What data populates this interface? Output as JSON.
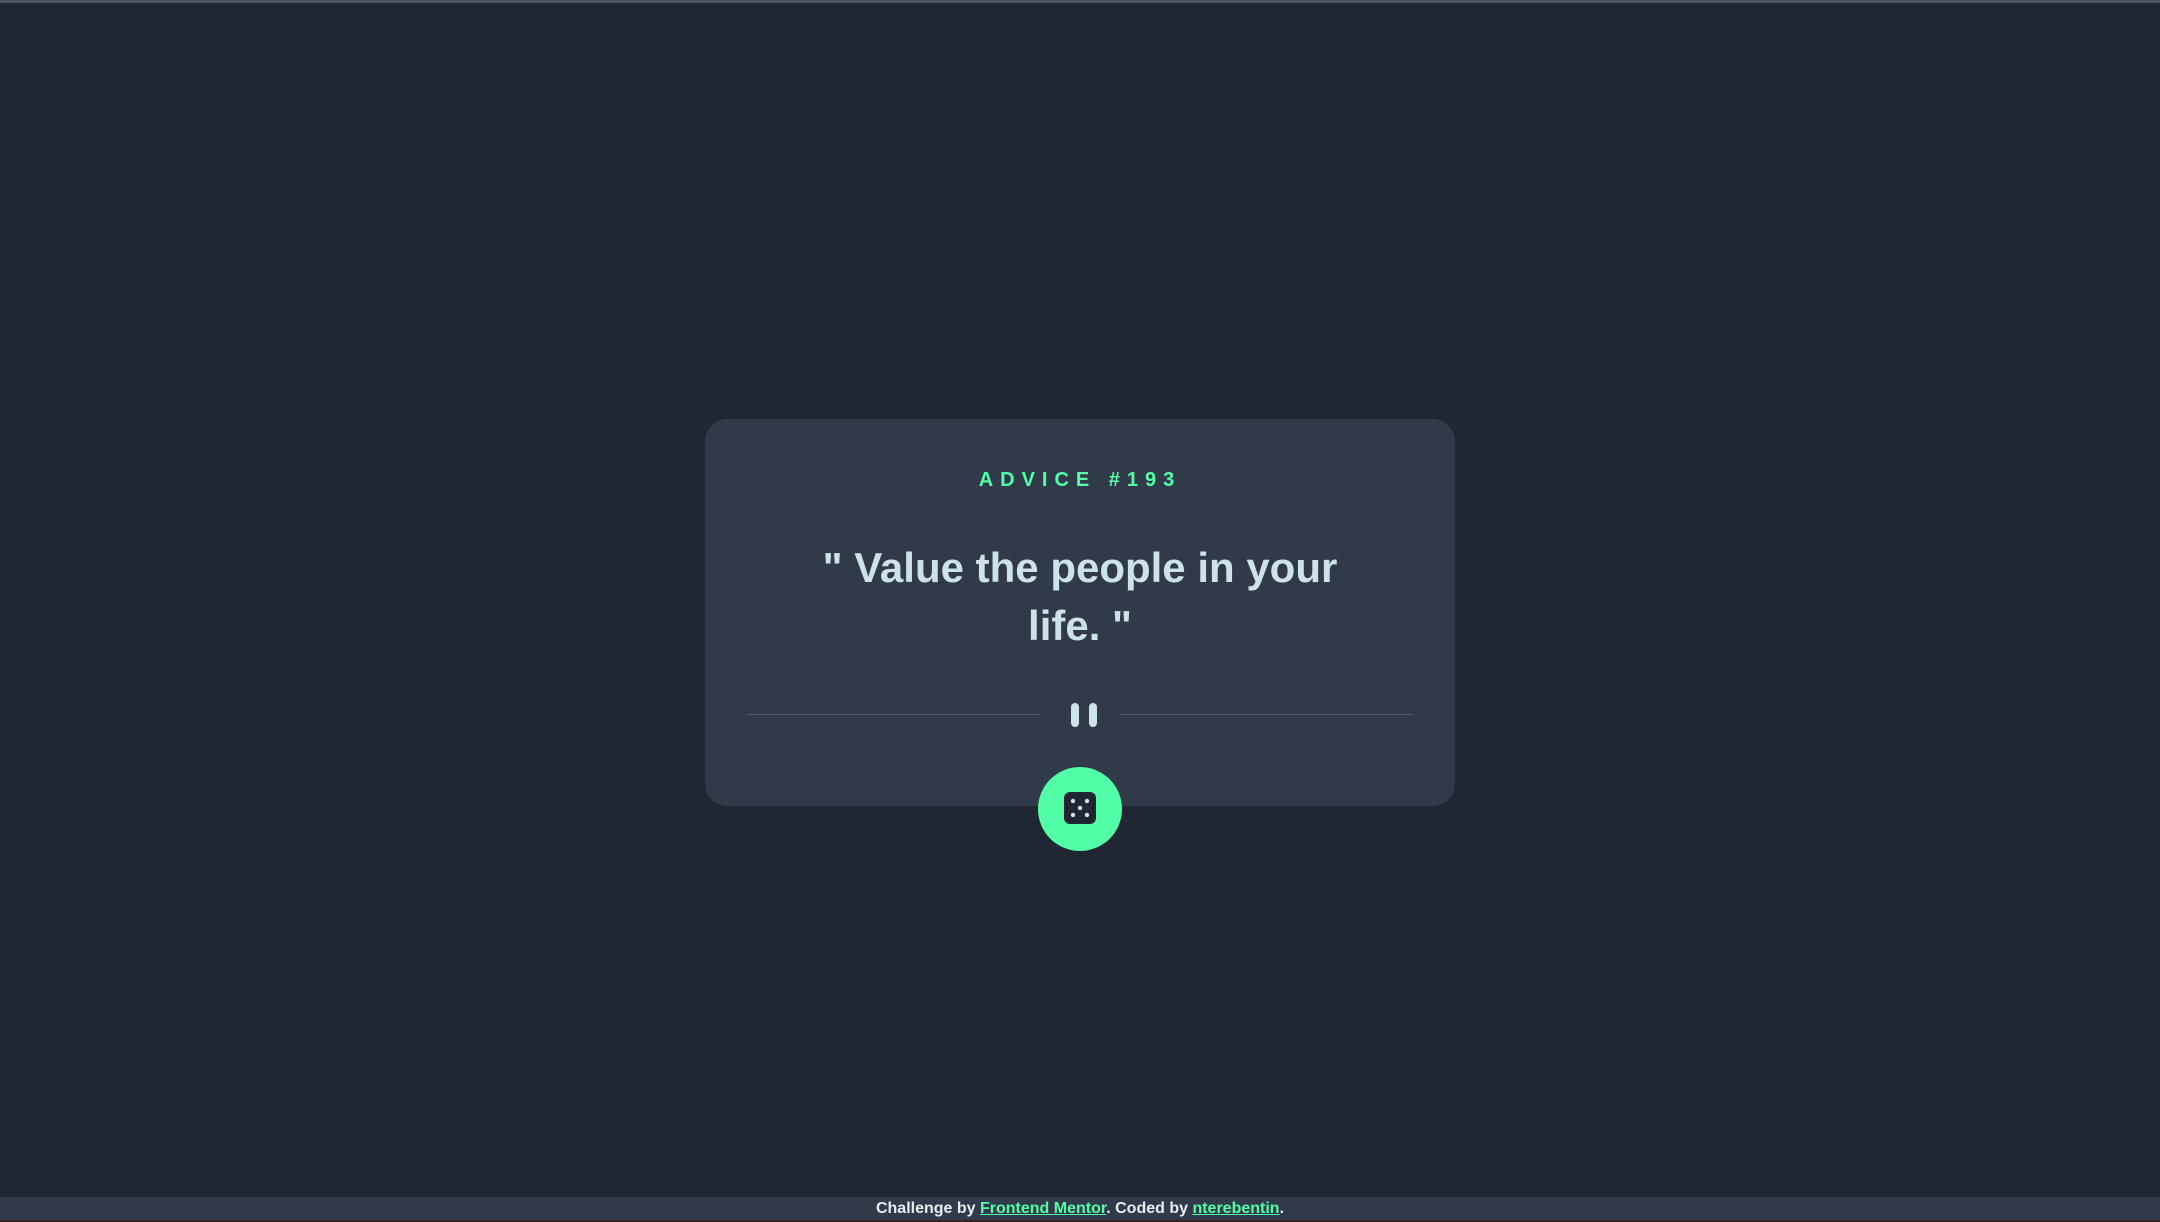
{
  "card": {
    "advice_id": "ADVICE #193",
    "quote": "\" Value the people in your life. \""
  },
  "dice_button": {
    "icon": "dice-icon"
  },
  "divider": {
    "icon": "pause-icon"
  },
  "footer": {
    "prefix": "Challenge by ",
    "link1": "Frontend Mentor",
    "middle": ". Coded by ",
    "link2": "nterebentin",
    "suffix": "."
  },
  "colors": {
    "background": "#202733",
    "card": "#313a48",
    "accent": "#52ffa8",
    "text": "#cee3e9"
  }
}
